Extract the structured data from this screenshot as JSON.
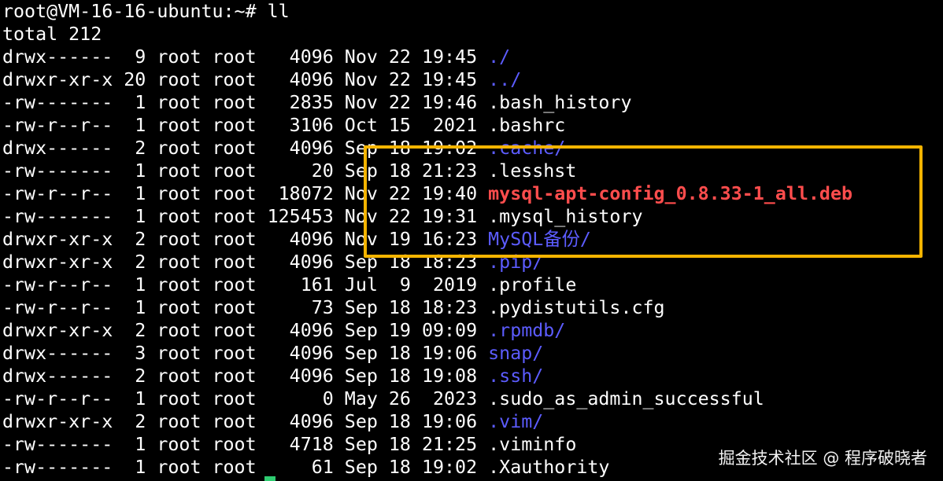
{
  "terminal": {
    "prompt": "root@VM-16-16-ubuntu:~# ll",
    "total": "total 212",
    "rows": [
      {
        "meta": "drwx------  9 root root   4096 Nov 22 19:45 ",
        "name": "./",
        "kind": "dir"
      },
      {
        "meta": "drwxr-xr-x 20 root root   4096 Nov 22 19:45 ",
        "name": "../",
        "kind": "dir"
      },
      {
        "meta": "-rw-------  1 root root   2835 Nov 22 19:46 ",
        "name": ".bash_history",
        "kind": "file"
      },
      {
        "meta": "-rw-r--r--  1 root root   3106 Oct 15  2021 ",
        "name": ".bashrc",
        "kind": "file"
      },
      {
        "meta": "drwx------  2 root root   4096 Sep 18 19:02 ",
        "name": ".cache/",
        "kind": "dir"
      },
      {
        "meta": "-rw-------  1 root root     20 Sep 18 21:23 ",
        "name": ".lesshst",
        "kind": "file"
      },
      {
        "meta": "-rw-r--r--  1 root root  18072 Nov 22 19:40 ",
        "name": "mysql-apt-config_0.8.33-1_all.deb",
        "kind": "deb"
      },
      {
        "meta": "-rw-------  1 root root 125453 Nov 22 19:31 ",
        "name": ".mysql_history",
        "kind": "file"
      },
      {
        "meta": "drwxr-xr-x  2 root root   4096 Nov 19 16:23 ",
        "name": "MySQL备份/",
        "kind": "dir"
      },
      {
        "meta": "drwxr-xr-x  2 root root   4096 Sep 18 18:23 ",
        "name": ".pip/",
        "kind": "dir"
      },
      {
        "meta": "-rw-r--r--  1 root root    161 Jul  9  2019 ",
        "name": ".profile",
        "kind": "file"
      },
      {
        "meta": "-rw-r--r--  1 root root     73 Sep 18 18:23 ",
        "name": ".pydistutils.cfg",
        "kind": "file"
      },
      {
        "meta": "drwxr-xr-x  2 root root   4096 Sep 19 09:09 ",
        "name": ".rpmdb/",
        "kind": "dir"
      },
      {
        "meta": "drwx------  3 root root   4096 Sep 18 19:06 ",
        "name": "snap/",
        "kind": "dir"
      },
      {
        "meta": "drwx------  2 root root   4096 Sep 18 19:08 ",
        "name": ".ssh/",
        "kind": "dir"
      },
      {
        "meta": "-rw-r--r--  1 root root      0 May 26  2023 ",
        "name": ".sudo_as_admin_successful",
        "kind": "file"
      },
      {
        "meta": "drwxr-xr-x  2 root root   4096 Sep 18 19:06 ",
        "name": ".vim/",
        "kind": "dir"
      },
      {
        "meta": "-rw-------  1 root root   4718 Sep 18 21:25 ",
        "name": ".viminfo",
        "kind": "file"
      },
      {
        "meta": "-rw-------  1 root root     61 Sep 18 19:02 ",
        "name": ".Xauthority",
        "kind": "file"
      }
    ]
  },
  "watermark": "掘金技术社区 @ 程序破晓者",
  "colors": {
    "background": "#000000",
    "text": "#ffffff",
    "directory": "#5c5cff",
    "deb_package": "#ff4d4d",
    "highlight_box": "#f5b400"
  }
}
